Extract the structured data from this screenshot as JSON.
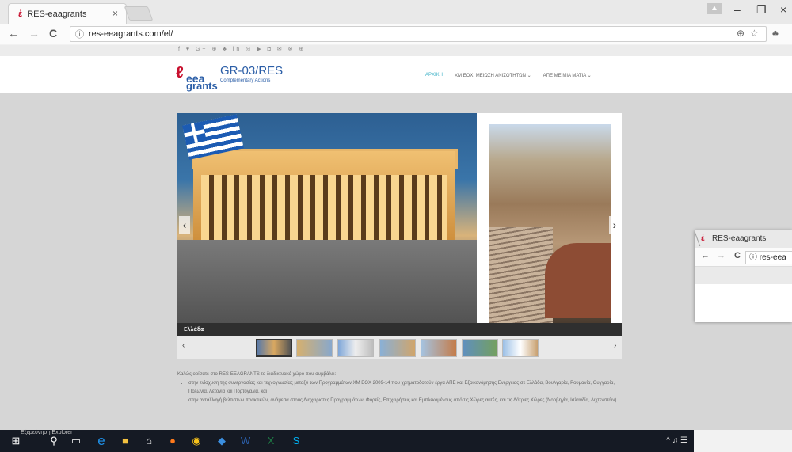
{
  "browser": {
    "tab_title": "RES-eaagrants",
    "tab_close": "×",
    "favicon": "ἐ",
    "url": "res-eeagrants.com/el/",
    "window_minimize": "–",
    "window_restore": "❐",
    "window_close": "×",
    "nav_back": "←",
    "nav_forward": "→",
    "nav_reload": "C",
    "info": "ⓘ",
    "zoom_icon": "⊕",
    "star_icon": "☆"
  },
  "site": {
    "social_icons": "f ♥ G+ ⊕ ♣ in ◎ ▶ ◘ ✉ ⊗ ⊕",
    "logo_eea": "eea",
    "logo_grants": "grants",
    "title": "GR-03/RES",
    "subtitle": "Complementary Actions",
    "menu": [
      {
        "label": "ΑΡΧΙΚΗ"
      },
      {
        "label": "ΧΜ ΕΟΧ: ΜΕΙΩΣΗ ΑΝΙΣΟΤΗΤΩΝ ⌄"
      },
      {
        "label": "ΑΠΕ ΜΕ ΜΙΑ ΜΑΤΙΑ ⌄"
      }
    ]
  },
  "slider": {
    "caption": "Ελλάδα",
    "prev": "‹",
    "next": "›",
    "thumb_prev": "‹",
    "thumb_next": "›",
    "thumbnails": [
      {
        "name": "thumb-1"
      },
      {
        "name": "thumb-2"
      },
      {
        "name": "thumb-3"
      },
      {
        "name": "thumb-4"
      },
      {
        "name": "thumb-5"
      },
      {
        "name": "thumb-6"
      },
      {
        "name": "thumb-7"
      }
    ]
  },
  "content": {
    "intro": "Καλώς ορίσατε στο RES-EEAGRANTS το διαδικτυακό χώρο που συμβάλει:",
    "bullets": [
      "στην ενίσχυση της συνεργασίας και τεχνογνωσίας μεταξύ των Προγραμμάτων ΧΜ ΕΟΧ 2009-14 που χρηματοδοτούν έργα ΑΠΕ και Εξοικονόμησης Ενέργειας σε Ελλάδα, Βουλγαρία, Ρουμανία, Ουγγαρία, Πολωνία, Λετονία και Πορτογαλία, και",
      "στην ανταλλαγή βέλτιστων πρακτικών, ανάμεσα στους Διαχειριστές Προγραμμάτων, Φορείς, Επιχειρήσεις και Εμπλεκομένους από τις Χώρες αυτές, και τις Δότριες Χώρες (Νορβηγία, Ισλανδία, Λιχτενστάιν)."
    ]
  },
  "float_window": {
    "tab_title": "RES-eaagrants",
    "url": "res-eea"
  },
  "taskbar": {
    "tooltip": "Εξερεύνηση Explorer",
    "tray": "^ ♫ ☰"
  }
}
